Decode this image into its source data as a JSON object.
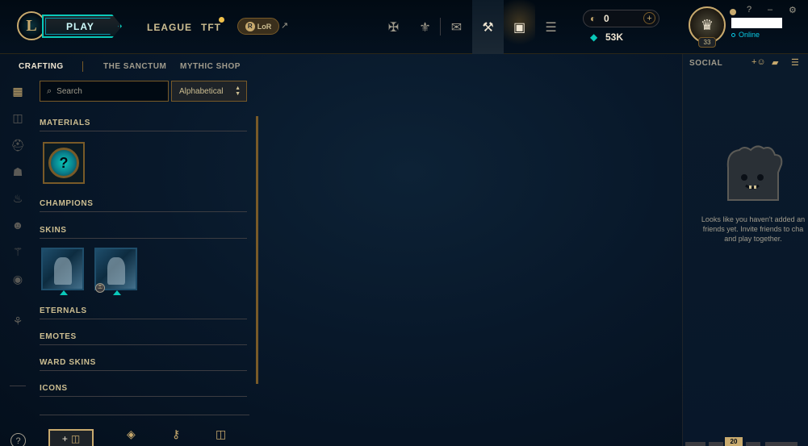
{
  "header": {
    "play_label": "PLAY",
    "nav": [
      "LEAGUE",
      "TFT"
    ],
    "lor_label": "LoR",
    "currency": {
      "rp_value": "0",
      "be_value": "53K"
    },
    "profile": {
      "level": "33",
      "status": "Online"
    },
    "window_controls": [
      "?",
      "–",
      "×"
    ]
  },
  "subnav": {
    "items": [
      "CRAFTING",
      "THE SANCTUM",
      "MYTHIC SHOP"
    ]
  },
  "search": {
    "placeholder": "Search",
    "sort_value": "Alphabetical"
  },
  "inventory": {
    "sections": [
      "MATERIALS",
      "CHAMPIONS",
      "SKINS",
      "ETERNALS",
      "EMOTES",
      "WARD SKINS",
      "ICONS"
    ]
  },
  "social": {
    "title": "SOCIAL",
    "empty_line1": "Looks like you haven't added an",
    "empty_line2": "friends yet. Invite friends to cha",
    "empty_line3": "and play together.",
    "badge": "20"
  },
  "colors": {
    "gold": "#c8aa6e",
    "teal": "#0ac8b9",
    "bg": "#010a13"
  }
}
